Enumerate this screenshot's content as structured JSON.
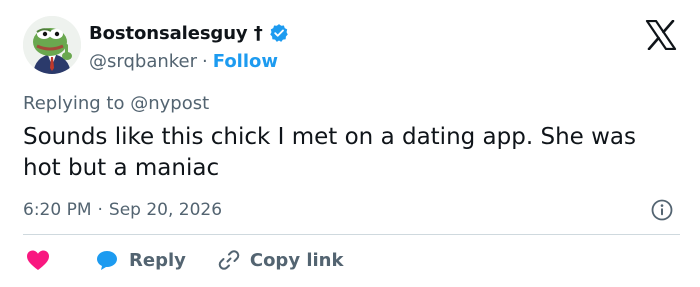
{
  "author": {
    "display_name": "Bostonsalesguy †",
    "handle": "@srqbanker",
    "separator": "·",
    "follow_label": "Follow",
    "verified_color": "#1d9bf0"
  },
  "reply_context": {
    "prefix": "Replying to ",
    "mention": "@nypost"
  },
  "tweet": {
    "text": "Sounds like this chick I met on a dating app. She was hot but a maniac",
    "time": "6:20 PM",
    "separator": "·",
    "date": "Sep 20, 2026"
  },
  "actions": {
    "like_icon": "heart-icon",
    "reply_label": "Reply",
    "copy_link_label": "Copy link"
  },
  "colors": {
    "accent": "#1d9bf0",
    "like": "#f91880",
    "text": "#0f1419",
    "muted": "#536471",
    "divider": "#cfd9de"
  }
}
